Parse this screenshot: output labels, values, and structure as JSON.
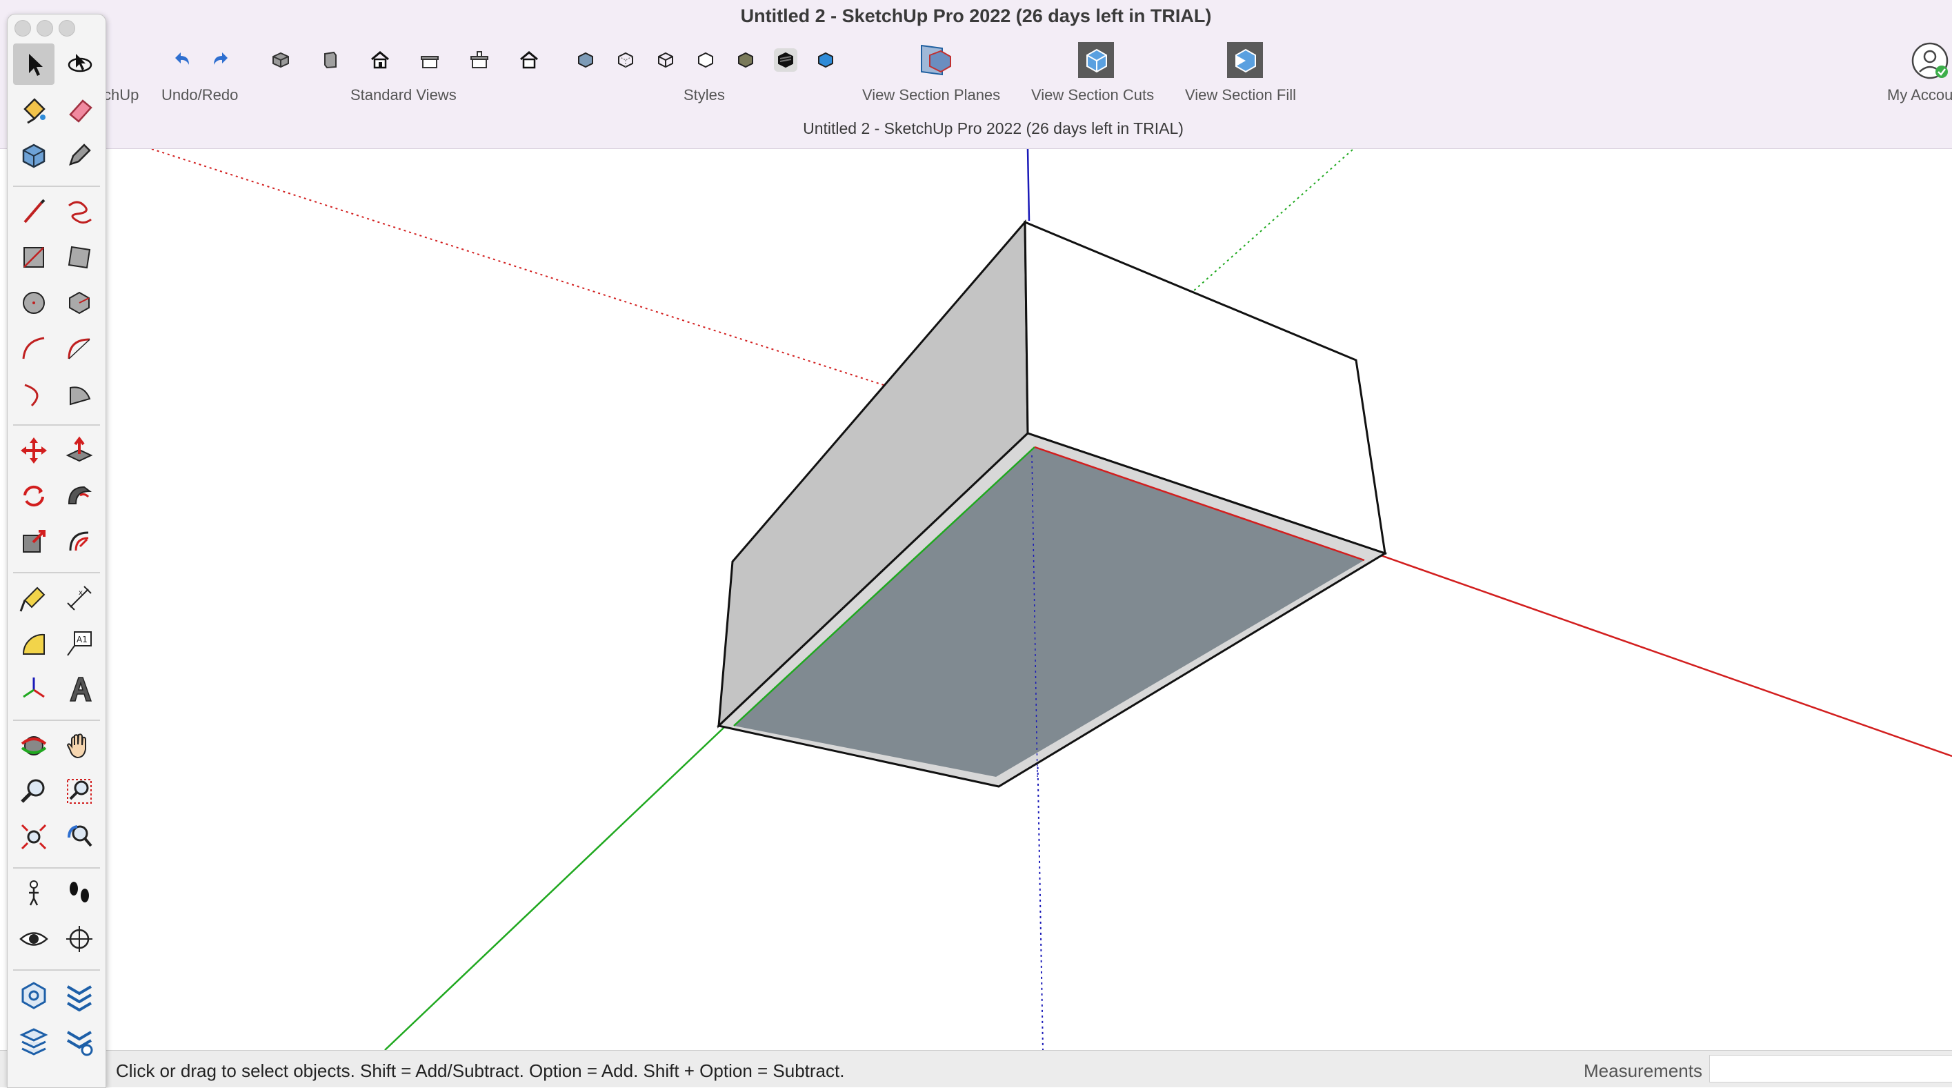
{
  "window": {
    "title": "Untitled 2 - SketchUp Pro 2022 (26 days left in TRIAL)",
    "document_title": "Untitled 2 - SketchUp Pro 2022 (26 days left in TRIAL)"
  },
  "toolbar": {
    "groups": {
      "sketchup": "chUp",
      "undo_redo": "Undo/Redo",
      "standard_views": "Standard Views",
      "styles": "Styles",
      "section_planes": "View Section Planes",
      "section_cuts": "View Section Cuts",
      "section_fill": "View Section Fill",
      "account": "My Accou"
    }
  },
  "status": {
    "hint": "Click or drag to select objects. Shift = Add/Subtract. Option = Add. Shift + Option = Subtract.",
    "measurements_label": "Measurements",
    "measurements_value": ""
  },
  "colors": {
    "x_axis": "#d21e1e",
    "y_axis": "#1fa81f",
    "z_axis": "#1a1ab8",
    "section_face": "#808a91",
    "side_face": "#c4c4c4",
    "accent_blue": "#2e8bd8"
  }
}
